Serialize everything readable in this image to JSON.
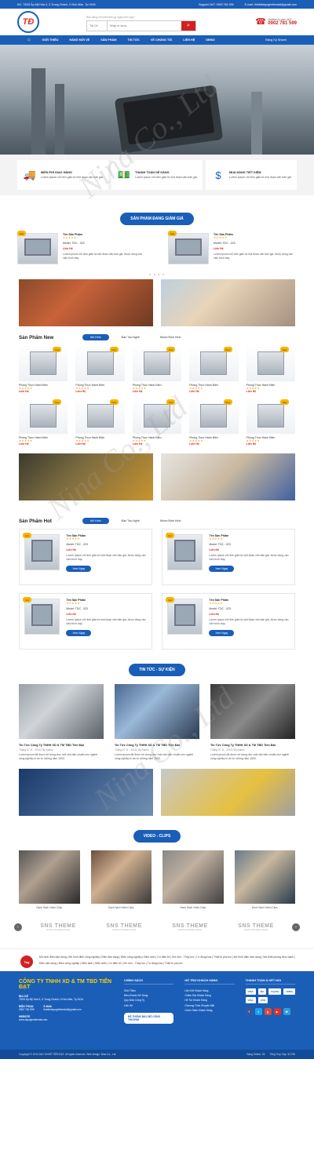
{
  "topbar": {
    "address": "ĐC: 73/25 Ấp Mỹ Hòa 3, X.Trung Chánh, H.Hóc Môn, Tp.HCM",
    "support": "Support 24/7: 0902 781 599",
    "email": "E-mail: thietbidaynghetiendat@gmail.com"
  },
  "header": {
    "logo": "TĐ",
    "hint": "Bạn đang tìm kiếm điều gì ngày hôm nay?",
    "search_select": "Tất Cả",
    "search_placeholder": "Nhập từ khóa...",
    "hotline_label": "Hotline tư vấn 24/7",
    "hotline": "0902 781 599"
  },
  "nav": {
    "items": [
      "GIỚI THIỆU",
      "HÀNG MỚI VỀ",
      "SẢN PHẨM",
      "TIN TỨC",
      "VỀ CHÚNG TÔI",
      "LIÊN HỆ",
      "DEMO"
    ],
    "user": "Đăng Ký Nhanh"
  },
  "features": [
    {
      "icon": "truck-icon",
      "title": "MIỄN PHÍ GIAO HÀNG",
      "desc": "Lorem ipsum chỉ đơn giản là một đoạn văn bản giả."
    },
    {
      "icon": "money-icon",
      "title": "THANH TOÁN DỄ DÀNG",
      "desc": "Lorem ipsum chỉ đơn giản là một đoạn văn bản giả."
    },
    {
      "icon": "tag-icon",
      "title": "MUA HÀNG TIẾT KIỆM",
      "desc": "Lorem ipsum chỉ đơn giản là một đoạn văn bản giả."
    }
  ],
  "deals": {
    "title": "SẢN PHẨM ĐANG GIẢM GIÁ",
    "items": [
      {
        "badge": "Sale",
        "name": "Tên Sản Phẩm",
        "stars": "★★★★★",
        "model": "Model: TDC - 023",
        "price": "Liên Hệ",
        "desc": "Lorem ipsum chỉ đơn giản là một đoạn văn bản giả, được dùng vào việc trình bày."
      },
      {
        "badge": "Sale",
        "name": "Tên Sản Phẩm",
        "stars": "★★★★★",
        "model": "Model: TDC - 023",
        "price": "Liên Hệ",
        "desc": "Lorem ipsum chỉ đơn giản là một đoạn văn bản giả, được dùng vào việc trình bày."
      }
    ],
    "dots": "● ● ● ●"
  },
  "new": {
    "title": "Sản Phẩm New",
    "tabs": [
      "Mô Hình",
      "Đào Tạo Nghề",
      "Nhóm Định Hình"
    ],
    "items": [
      {
        "name": "Phòng Thực Hành Điện",
        "stars": "★★★★★",
        "price": "Liên Hệ",
        "badge": "New"
      },
      {
        "name": "Phòng Thực Hành Điện",
        "stars": "★★★★★",
        "price": "Liên Hệ",
        "badge": "New"
      },
      {
        "name": "Phòng Thực Hành Điện",
        "stars": "★★★★★",
        "price": "Liên Hệ",
        "badge": "New"
      },
      {
        "name": "Phòng Thực Hành Điện",
        "stars": "★★★★★",
        "price": "Liên Hệ",
        "badge": "New"
      },
      {
        "name": "Phòng Thực Hành Điện",
        "stars": "★★★★★",
        "price": "Liên Hệ",
        "badge": "New"
      },
      {
        "name": "Phòng Thực Hành Điện",
        "stars": "★★★★★",
        "price": "Liên Hệ",
        "badge": "New"
      },
      {
        "name": "Phòng Thực Hành Điện",
        "stars": "★★★★★",
        "price": "Liên Hệ",
        "badge": "New"
      },
      {
        "name": "Phòng Thực Hành Điện",
        "stars": "★★★★★",
        "price": "Liên Hệ",
        "badge": "New"
      },
      {
        "name": "Phòng Thực Hành Điện",
        "stars": "★★★★★",
        "price": "Liên Hệ",
        "badge": "New"
      },
      {
        "name": "Phòng Thực Hành Điện",
        "stars": "★★★★★",
        "price": "Liên Hệ",
        "badge": "New"
      }
    ]
  },
  "hot": {
    "title": "Sản Phẩm Hot",
    "tabs": [
      "Mô Hình",
      "Đào Tạo Nghề",
      "Nhóm Định Hình"
    ],
    "items": [
      {
        "badge": "Hot",
        "name": "Tên Sản Phẩm",
        "stars": "★★★★★",
        "model": "Model: TDC - 023",
        "price": "Liên Hệ",
        "desc": "Lorem ipsum chỉ đơn giản là một đoạn văn bản giả, được dùng vào việc trình bày.",
        "button": "Xem Ngay"
      },
      {
        "badge": "Hot",
        "name": "Tên Sản Phẩm",
        "stars": "★★★★★",
        "model": "Model: TDC - 023",
        "price": "Liên Hệ",
        "desc": "Lorem ipsum chỉ đơn giản là một đoạn văn bản giả, được dùng vào việc trình bày.",
        "button": "Xem Ngay"
      },
      {
        "badge": "Hot",
        "name": "Tên Sản Phẩm",
        "stars": "★★★★★",
        "model": "Model: TDC - 023",
        "price": "Liên Hệ",
        "desc": "Lorem ipsum chỉ đơn giản là một đoạn văn bản giả, được dùng vào việc trình bày.",
        "button": "Xem Ngay"
      },
      {
        "badge": "Hot",
        "name": "Tên Sản Phẩm",
        "stars": "★★★★★",
        "model": "Model: TDC - 023",
        "price": "Liên Hệ",
        "desc": "Lorem ipsum chỉ đơn giản là một đoạn văn bản giả, được dùng vào việc trình bày.",
        "button": "Xem Ngay"
      }
    ]
  },
  "news": {
    "title": "TIN TỨC - SỰ KIỆN",
    "items": [
      {
        "title": "Tin Tức Công Ty TNHH XD & TM TBD Tiến Đạt",
        "date": "Tháng 07 11 - 2016 | By Admin",
        "desc": "Lorem ipsum đã được sử dụng như một văn bản chuẩn cho ngành công nghiệp in ấn từ những năm 1500."
      },
      {
        "title": "Tin Tức Công Ty TNHH XD & TM TBD Tiến Đạt",
        "date": "Tháng 07 11 - 2016 | By Admin",
        "desc": "Lorem ipsum đã được sử dụng như một văn bản chuẩn cho ngành công nghiệp in ấn từ những năm 1500."
      },
      {
        "title": "Tin Tức Công Ty TNHH XD & TM TBD Tiến Đạt",
        "date": "Tháng 07 11 - 2016 | By Admin",
        "desc": "Lorem ipsum đã được sử dụng như một văn bản chuẩn cho ngành công nghiệp in ấn từ những năm 1500."
      }
    ]
  },
  "videos": {
    "title": "VIDEO - CLIPS",
    "items": [
      "Danh Sách Video Clips",
      "Danh Sách Video Clips",
      "Danh Sách Video Clips",
      "Danh Sách Video Clips"
    ]
  },
  "partners": [
    {
      "logo": "SNS THEME",
      "sub": "Creative Templates design"
    },
    {
      "logo": "SNS THEME",
      "sub": "Creative Templates design"
    },
    {
      "logo": "SNS THEME",
      "sub": "Creative Templates design"
    },
    {
      "logo": "SNS THEME",
      "sub": "Creative Templates design"
    }
  ],
  "tags": {
    "icon": "Tag",
    "text": "Mô hình điện dân dụng | Mô hình điện công nghiệp | Điện dân dụng | Điện công nghiệp | Điện lạnh | Cơ điện tử | Khí nén - Thủy lực | Tự động hóa | Thiết bị phụ trợ | Mô hình điện dân dụng | Nối thiết phòng thực hành | Điện dân dụng | Điện công nghiệp | Điện lạnh | Điện lạnh | Cơ điện tử | Khí nén - Thủy lực | Tự động hóa | Thiết bị phụ trợ"
  },
  "footer": {
    "company": "CÔNG TY TNHH XD & TM TBD TIẾN ĐẠT",
    "addr_label": "ĐỊA CHỈ",
    "addr": "73/25 Ấp Mỹ Hòa 3, X.Trung Chánh, H.Hóc Môn, Tp.HCM",
    "phone_label": "ĐIỆN THOẠI",
    "phone": "0902 781 599",
    "email_label": "E-MAIL",
    "email": "thietbidaynghetiendat@gmail.com",
    "web_label": "WEBSITE",
    "web": "www.daynghetiendat.com",
    "policy_title": "CHÍNH SÁCH",
    "policy": [
      "Giới Thiệu",
      "Điều Khoản Sử Dụng",
      "Quy Định Công Ty",
      "Liên Hệ"
    ],
    "badge": "ĐÃ THÔNG BÁO BỘ CÔNG THƯƠNG",
    "support_title": "HỖ TRỢ KHÁCH HÀNG",
    "support": [
      "Liên Kết Khách Hàng",
      "Chăm Sóc Khách Hàng",
      "Hỗ Trợ Khách Hàng",
      "Chương Trình Khuyến Mãi",
      "Chính Sách Khách Hàng"
    ],
    "pay_title": "THANH TOÁN & KẾT NỐI",
    "pays": [
      "VISA",
      "MC",
      "PayPal",
      "AMEX",
      "VISA",
      "ATM"
    ],
    "social": [
      {
        "n": "f",
        "c": "#3b5998"
      },
      {
        "n": "t",
        "c": "#1da1f2"
      },
      {
        "n": "g",
        "c": "#dd4b39"
      },
      {
        "n": "▶",
        "c": "#e52d27"
      },
      {
        "n": "✉",
        "c": "#2ba0d9"
      }
    ]
  },
  "copyright": {
    "left": "Copyright © 2016 DẠY NGHỀ TIẾN ĐẠT. All rights reserved. Web design: Nina Co., Ltd",
    "online": "Đang Online: 25",
    "total": "Tổng Truy Cập: 32,796"
  },
  "watermark": "Nina Co., Ltd"
}
